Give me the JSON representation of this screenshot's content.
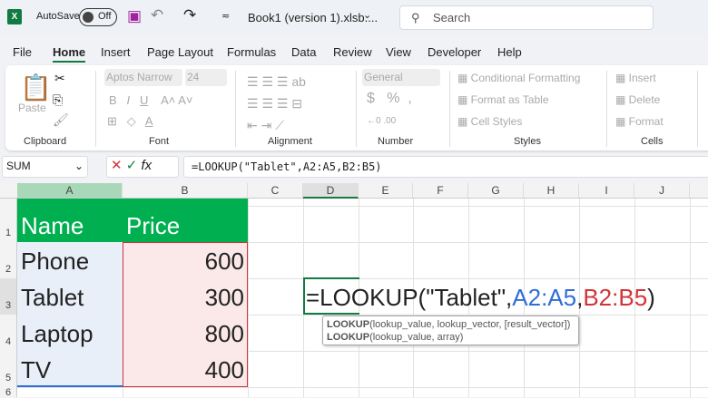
{
  "titlebar": {
    "autosave_label": "AutoSave",
    "autosave_state": "Off",
    "filename": "Book1 (version 1).xlsb....",
    "search_placeholder": "Search"
  },
  "tabs": [
    "File",
    "Home",
    "Insert",
    "Page Layout",
    "Formulas",
    "Data",
    "Review",
    "View",
    "Developer",
    "Help"
  ],
  "ribbon": {
    "paste": "Paste",
    "font_name": "Aptos Narrow",
    "font_size": "24",
    "number_format": "General",
    "cond_format": "Conditional Formatting",
    "format_table": "Format as Table",
    "cell_styles": "Cell Styles",
    "insert": "Insert",
    "delete": "Delete",
    "format": "Format",
    "groups": [
      "Clipboard",
      "Font",
      "Alignment",
      "Number",
      "Styles",
      "Cells"
    ]
  },
  "formula_bar": {
    "name_box": "SUM",
    "formula": "=LOOKUP(\"Tablet\",A2:A5,B2:B5)"
  },
  "columns": [
    "A",
    "B",
    "C",
    "D",
    "E",
    "F",
    "G",
    "H",
    "I",
    "J"
  ],
  "rows": [
    "1",
    "2",
    "3",
    "4",
    "5",
    "6"
  ],
  "cells": {
    "a1": "Name",
    "b1": "Price",
    "a2": "Phone",
    "b2": "600",
    "a3": "Tablet",
    "b3": "300",
    "a4": "Laptop",
    "b4": "800",
    "a5": "TV",
    "b5": "400"
  },
  "edit": {
    "prefix": "=LOOKUP(\"Tablet\",",
    "ref1": "A2:A5",
    "comma": ",",
    "ref2": "B2:B5",
    "close": ")"
  },
  "tooltip": {
    "fn": "LOOKUP",
    "sig1": "(lookup_value, lookup_vector, [result_vector])",
    "sig2": "(lookup_value, array)"
  },
  "colors": {
    "header_green": "#00b050",
    "ref_blue": "#2f6fd6",
    "ref_red": "#d13438"
  }
}
